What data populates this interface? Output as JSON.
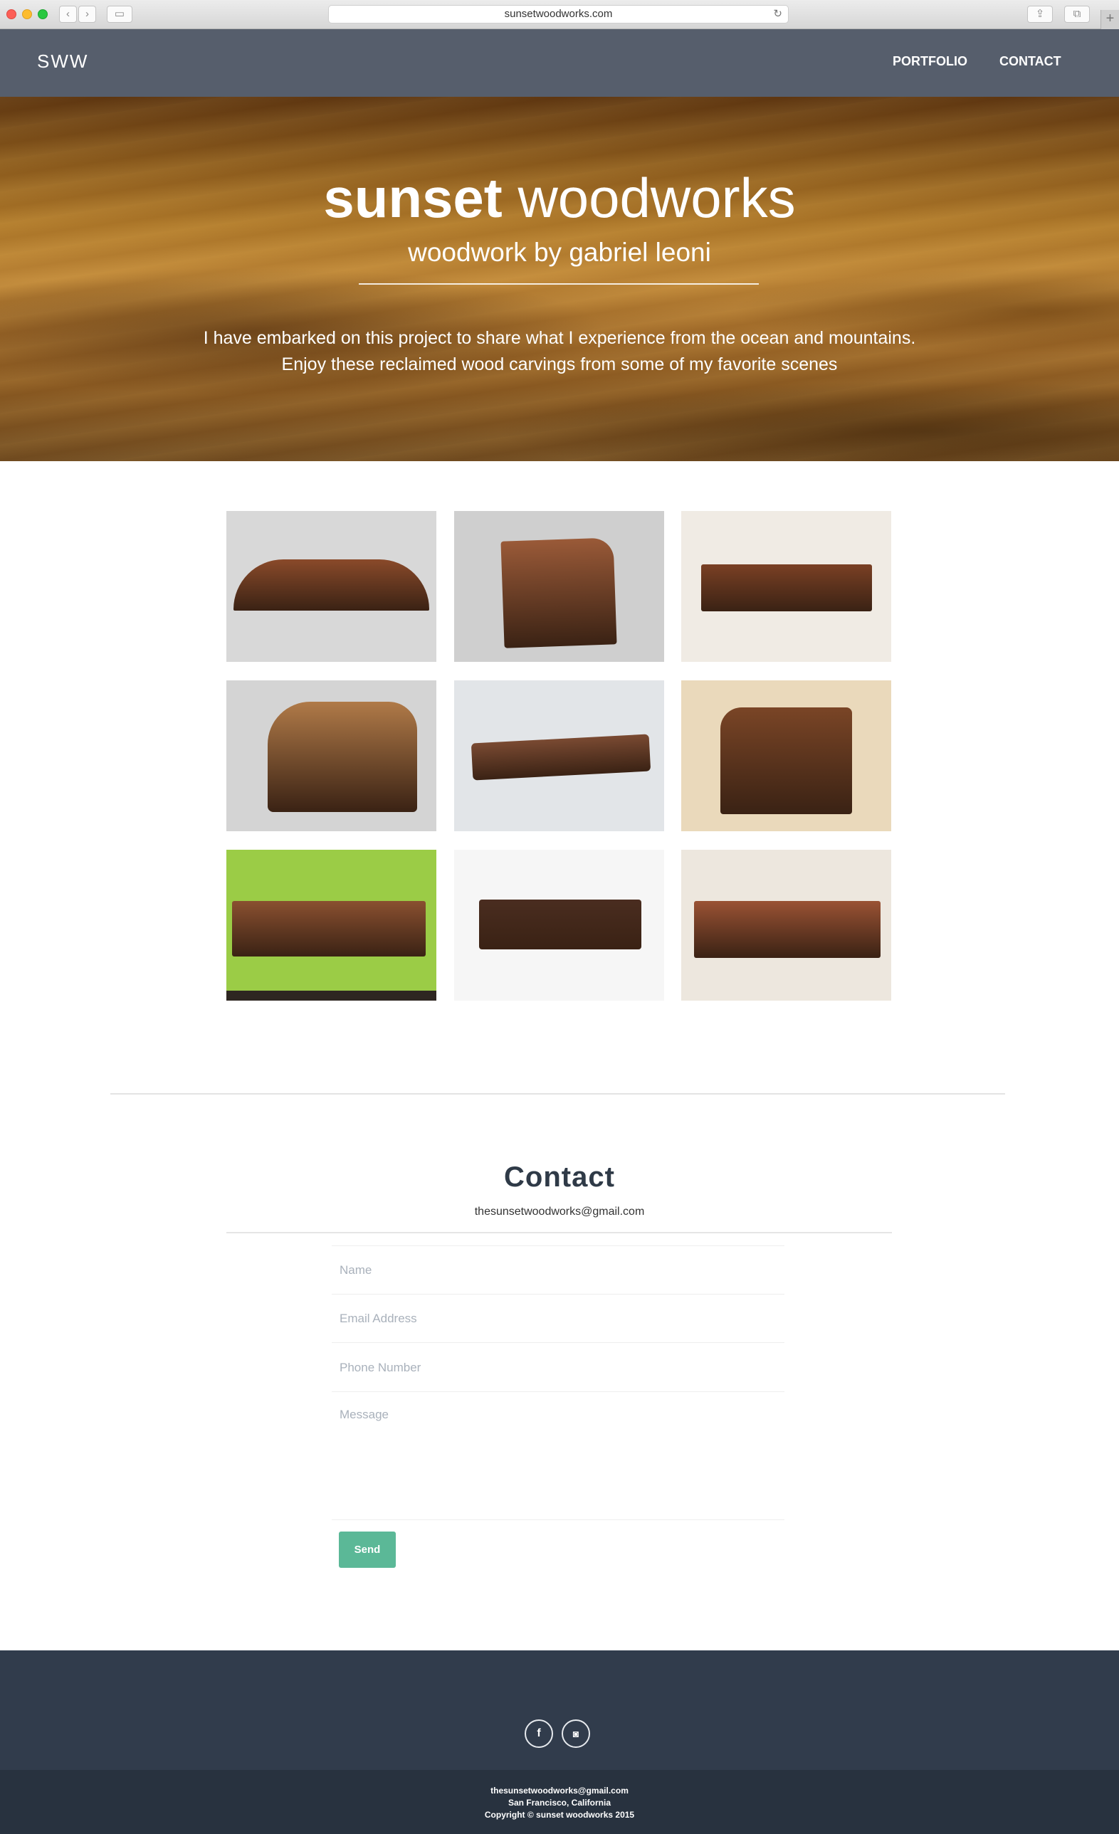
{
  "browser": {
    "url": "sunsetwoodworks.com"
  },
  "nav": {
    "brand": "SWW",
    "links": [
      "PORTFOLIO",
      "CONTACT"
    ]
  },
  "hero": {
    "title_bold": "sunset",
    "title_light": "woodworks",
    "subtitle": "woodwork by gabriel leoni",
    "text_line1": "I have embarked on this project to share what I experience from the ocean and mountains.",
    "text_line2": "Enjoy these reclaimed wood carvings from some of my favorite scenes"
  },
  "gallery": {
    "items": [
      {
        "background": "#d8d8d8",
        "wood": "#8a4a2a"
      },
      {
        "background": "#cfcfcf",
        "wood": "#9a5a38"
      },
      {
        "background": "#f0ebe4",
        "wood": "#7a4024"
      },
      {
        "background": "#d4d4d4",
        "wood": "#b07a48"
      },
      {
        "background": "#e2e5e8",
        "wood": "#7a4a32"
      },
      {
        "background": "#ead9bb",
        "wood": "#7a4526"
      },
      {
        "background": "#9bcc46",
        "wood": "#8a5030"
      },
      {
        "background": "#f6f6f6",
        "wood": "#4a2d20"
      },
      {
        "background": "#ede7de",
        "wood": "#9a5234"
      }
    ]
  },
  "contact": {
    "title": "Contact",
    "email": "thesunsetwoodworks@gmail.com",
    "fields": {
      "name_placeholder": "Name",
      "email_placeholder": "Email Address",
      "phone_placeholder": "Phone Number",
      "message_placeholder": "Message"
    },
    "send_label": "Send"
  },
  "footer": {
    "social": [
      {
        "icon": "facebook-icon",
        "glyph": "f"
      },
      {
        "icon": "instagram-icon",
        "glyph": "◙"
      }
    ],
    "email": "thesunsetwoodworks@gmail.com",
    "location": "San Francisco, California",
    "copyright": "Copyright © sunset woodworks 2015"
  },
  "colors": {
    "nav": "#565e6c",
    "accent": "#5bb897",
    "footer": "#313c4c",
    "footer_bottom": "#28323f",
    "heading": "#2f3a47"
  }
}
